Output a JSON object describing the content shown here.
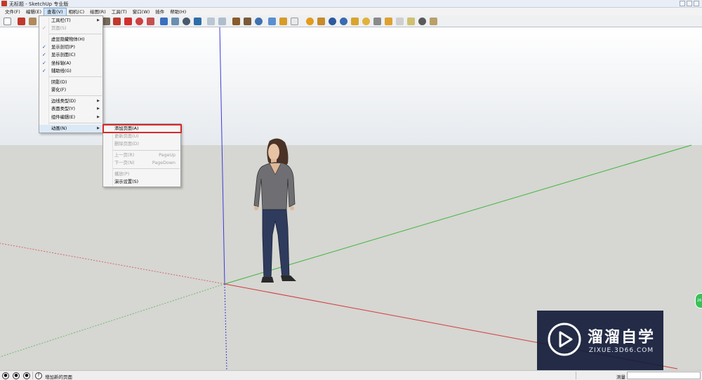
{
  "window": {
    "title": "无标题 - SketchUp 专业版"
  },
  "menubar": {
    "items": [
      "文件(F)",
      "编辑(E)",
      "查看(V)",
      "相机(C)",
      "绘图(R)",
      "工具(T)",
      "窗口(W)",
      "插件",
      "帮助(H)"
    ],
    "active_index": 2
  },
  "view_menu": {
    "items": [
      {
        "label": "工具栏(T)",
        "submenu": true
      },
      {
        "label": "页面(S)",
        "disabled": true,
        "checked": true
      },
      {
        "label": "虚显隐藏物体(H)"
      },
      {
        "label": "显示剖切(P)",
        "checked": true
      },
      {
        "label": "显示剖面(C)",
        "checked": true
      },
      {
        "label": "坐标轴(A)",
        "checked": true
      },
      {
        "label": "辅助线(G)",
        "checked": true
      },
      {
        "label": "阴影(D)"
      },
      {
        "label": "雾化(F)"
      },
      {
        "label": "边线类型(D)",
        "submenu": true
      },
      {
        "label": "表面类型(Y)",
        "submenu": true
      },
      {
        "label": "组件编辑(E)",
        "submenu": true
      },
      {
        "label": "动画(N)",
        "submenu": true,
        "highlighted": true
      }
    ]
  },
  "animation_submenu": {
    "items": [
      {
        "label": "添加页面(A)",
        "selected": true
      },
      {
        "label": "更新页面(U)",
        "disabled": true
      },
      {
        "label": "删除页面(D)",
        "disabled": true
      },
      {
        "label": "上一页(R)",
        "shortcut": "PageUp",
        "disabled": true
      },
      {
        "label": "下一页(N)",
        "shortcut": "PageDown",
        "disabled": true
      },
      {
        "label": "播放(P)",
        "disabled": true
      },
      {
        "label": "演示设置(S)"
      }
    ]
  },
  "statusbar": {
    "hint": "增加新的页面",
    "measure_label": "测量",
    "measure_value": ""
  },
  "watermark": {
    "title": "溜溜自学",
    "url": "ZIXUE.3D66.COM"
  },
  "side_badge": "26",
  "colors": {
    "axis_red": "#d23b3b",
    "axis_green": "#3bb53b",
    "axis_blue": "#3b3bd6",
    "highlight_outline": "#d62a2a",
    "sky_top": "#ffffff",
    "ground": "#d6d6d2"
  }
}
